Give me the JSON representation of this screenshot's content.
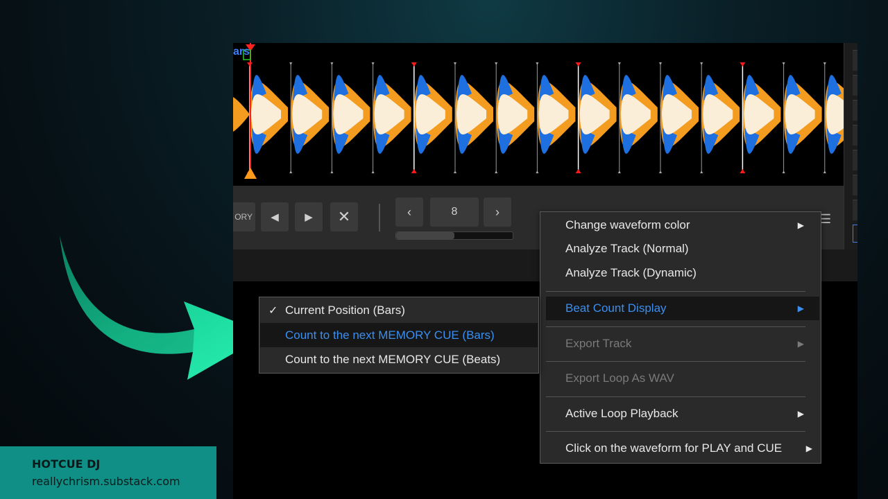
{
  "waveform": {
    "bars_label": "ars",
    "colors": {
      "orange": "#f39c1f",
      "blue": "#1e6fe0",
      "cream": "#fbeed8",
      "white": "#ffffff"
    }
  },
  "controls": {
    "memory_label": "ORY",
    "prev_icon": "triangle-left-icon",
    "next_icon": "triangle-right-icon",
    "delete_icon": "close-icon",
    "count_value": "8",
    "count_prev_icon": "chevron-left-icon",
    "count_next_icon": "chevron-right-icon",
    "progress": 0.5
  },
  "context_menu": {
    "items": [
      {
        "label": "Change waveform color",
        "has_submenu": true
      },
      {
        "label": "Analyze Track (Normal)",
        "has_submenu": false
      },
      {
        "label": "Analyze Track (Dynamic)",
        "has_submenu": false
      },
      {
        "label": "Beat Count Display",
        "has_submenu": true,
        "highlight": true
      },
      {
        "label": "Export Track",
        "has_submenu": true,
        "disabled": true
      },
      {
        "label": "Export Loop As WAV",
        "has_submenu": false,
        "disabled": true
      },
      {
        "label": "Active Loop Playback",
        "has_submenu": true
      },
      {
        "label": "Click on the waveform for PLAY and CUE",
        "has_submenu": true
      }
    ]
  },
  "sub_menu": {
    "items": [
      {
        "label": "Current Position (Bars)",
        "checked": true
      },
      {
        "label": "Count to the next MEMORY CUE (Bars)",
        "highlight": true
      },
      {
        "label": "Count to the next MEMORY CUE (Beats)"
      }
    ]
  },
  "brand": {
    "title": "HOTCUE DJ",
    "url": "reallychrism.substack.com"
  },
  "accent_color": "#3b8ff0",
  "arrow_color": "#1fe3a0"
}
